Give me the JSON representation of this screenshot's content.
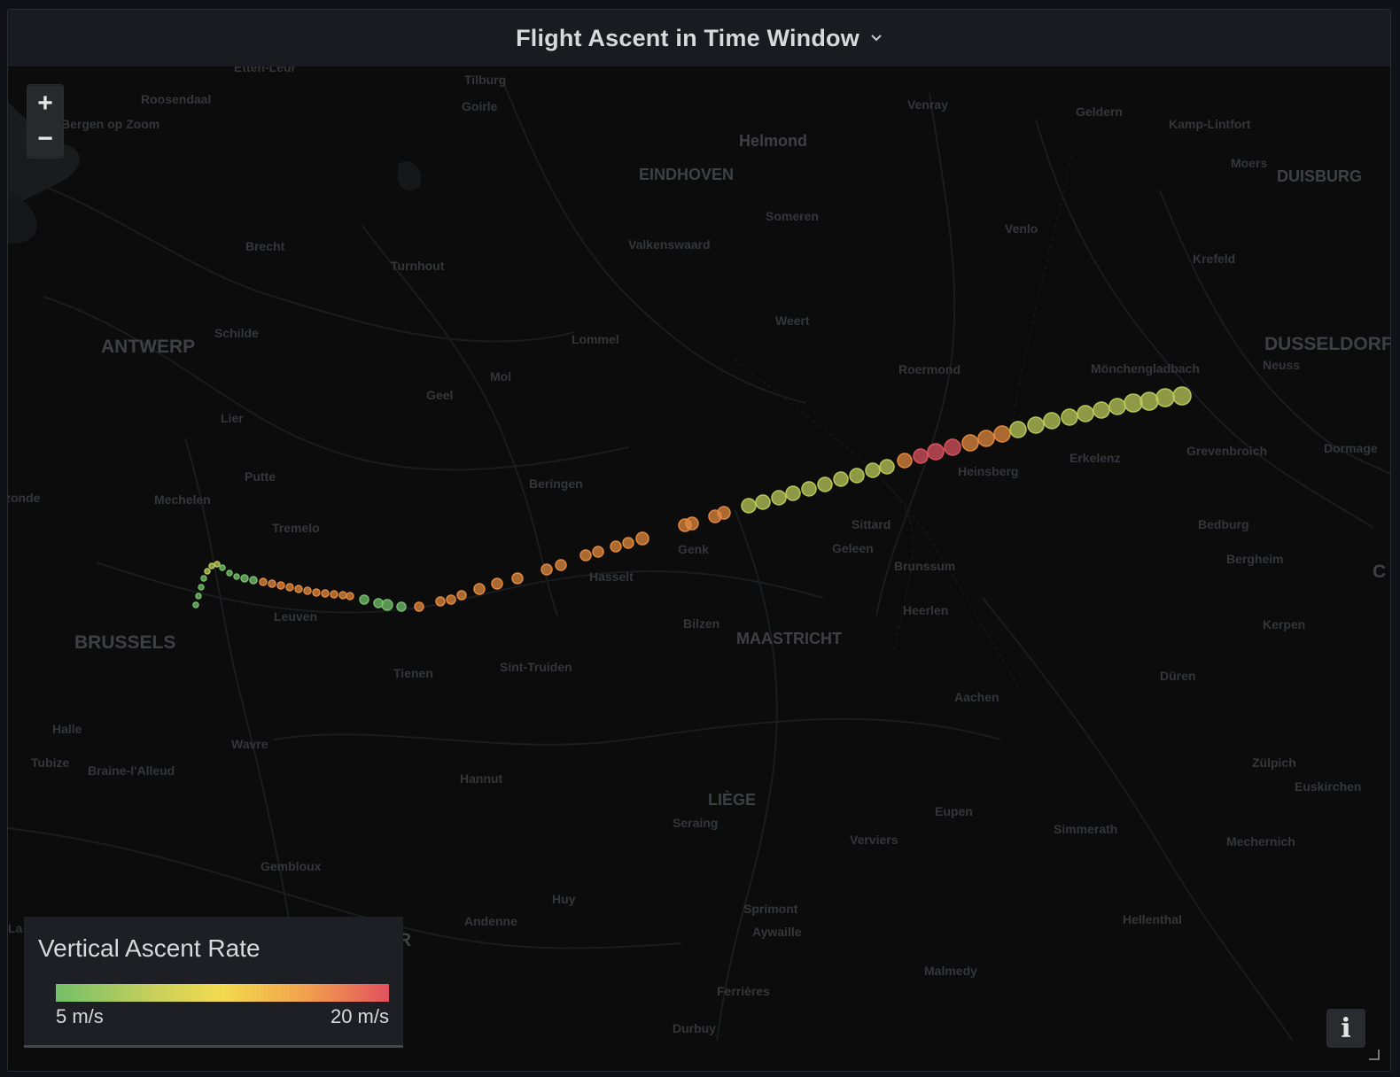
{
  "panel": {
    "title": "Flight Ascent in Time Window",
    "chevron_icon": "chevron-down-icon"
  },
  "map": {
    "zoom_in_label": "+",
    "zoom_out_label": "−",
    "labels": {
      "etten_leur": "Etten-Leur",
      "tilburg": "Tilburg",
      "goirle": "Goirle",
      "roosendaal": "Roosendaal",
      "bergen_op_zoom": "Bergen op Zoom",
      "venray": "Venray",
      "geldern": "Geldern",
      "kamp_lintfort": "Kamp-Lintfort",
      "helmond": "Helmond",
      "eindhoven": "EINDHOVEN",
      "moers": "Moers",
      "duisburg": "DUISBURG",
      "someren": "Someren",
      "venlo": "Venlo",
      "brecht": "Brecht",
      "valkenswaard": "Valkenswaard",
      "turnhout": "Turnhout",
      "krefeld": "Krefeld",
      "weert": "Weert",
      "schilde": "Schilde",
      "antwerp": "ANTWERP",
      "lommel": "Lommel",
      "dusseldorf": "DUSSELDORF",
      "neuss": "Neuss",
      "roermond": "Roermond",
      "monchengladbach": "Mönchengladbach",
      "mol": "Mol",
      "geel": "Geel",
      "lier": "Lier",
      "erkelenz": "Erkelenz",
      "grevenbroich": "Grevenbroich",
      "dormagen": "Dormage",
      "heinsberg": "Heinsberg",
      "putte": "Putte",
      "beringen": "Beringen",
      "mechelen": "Mechelen",
      "zonde": "zonde",
      "tremelo": "Tremelo",
      "sittard": "Sittard",
      "bedburg": "Bedburg",
      "genk": "Genk",
      "geleen": "Geleen",
      "bergheim": "Bergheim",
      "brunssum": "Brunssum",
      "hasselt": "Hasselt",
      "heerlen": "Heerlen",
      "leuven": "Leuven",
      "bilzen": "Bilzen",
      "kerpen": "Kerpen",
      "brussels": "BRUSSELS",
      "maastricht": "MAASTRICHT",
      "sint_truiden": "Sint-Truiden",
      "tienen": "Tienen",
      "duren": "Düren",
      "aachen": "Aachen",
      "halle": "Halle",
      "wavre": "Wavre",
      "zulpich": "Zülpich",
      "tubize": "Tubize",
      "braine": "Braine-l'Alleud",
      "hannut": "Hannut",
      "euskirchen": "Euskirchen",
      "liege": "LIÈGE",
      "eupen": "Eupen",
      "seraing": "Seraing",
      "simmerath": "Simmerath",
      "verviers": "Verviers",
      "mechernich": "Mechernich",
      "gembloux": "Gembloux",
      "huy": "Huy",
      "sprimont": "Sprimont",
      "andenne": "Andenne",
      "aywaille": "Aywaille",
      "hellenthal": "Hellenthal",
      "malmedy": "Malmedy",
      "ferrieres": "Ferrières",
      "durbuy": "Durbuy",
      "la": "La",
      "r_edge": "R",
      "c_edge": "C"
    }
  },
  "legend": {
    "title": "Vertical Ascent Rate",
    "min_label": "5 m/s",
    "max_label": "20 m/s",
    "colors": [
      "#73bf69",
      "#f3da4e",
      "#f2a14d",
      "#e2525d"
    ]
  },
  "info_button": {
    "label": "i",
    "icon": "info-icon"
  }
}
